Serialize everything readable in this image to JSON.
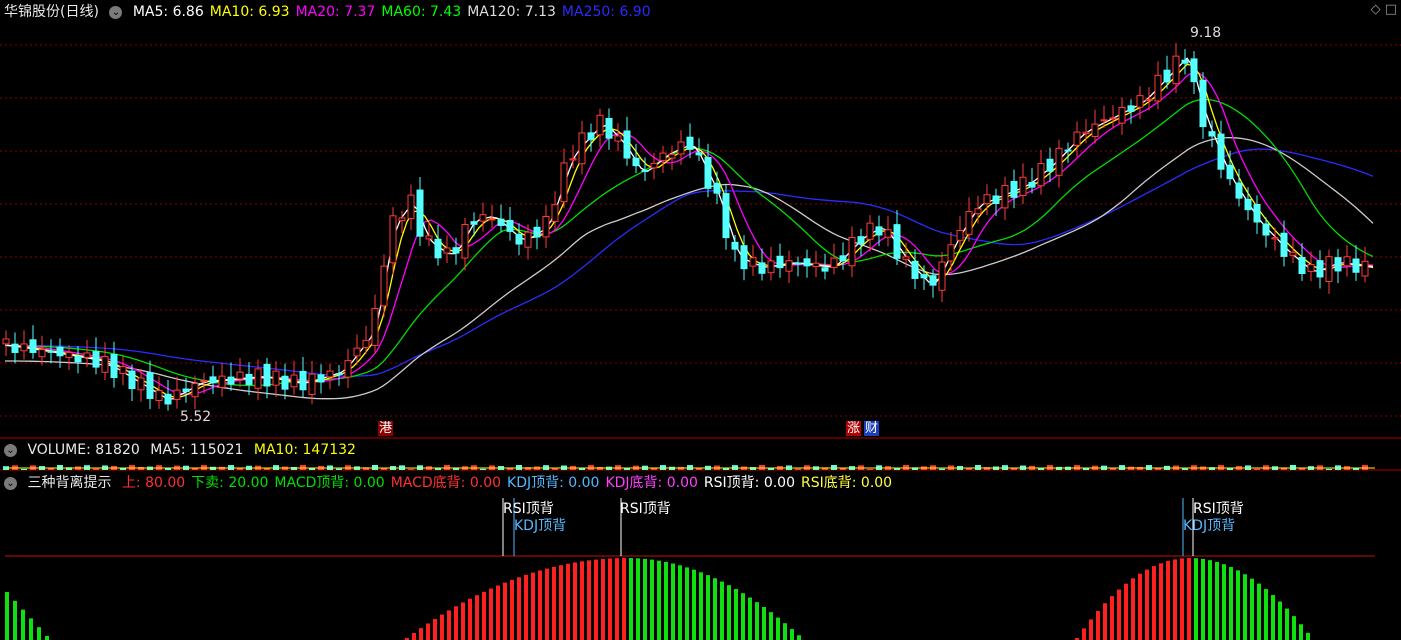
{
  "main": {
    "stock_name": "华锦股份(日线)",
    "ma": [
      {
        "label": "MA5: 6.86",
        "color": "#ffffff"
      },
      {
        "label": "MA10: 6.93",
        "color": "#ffff00"
      },
      {
        "label": "MA20: 7.37",
        "color": "#ff00ff"
      },
      {
        "label": "MA60: 7.43",
        "color": "#00ff00"
      },
      {
        "label": "MA120: 7.13",
        "color": "#dddddd"
      },
      {
        "label": "MA250: 6.90",
        "color": "#2b2bff"
      }
    ],
    "high_label": "9.18",
    "low_label": "5.52",
    "tags": [
      "港",
      "涨",
      "财"
    ]
  },
  "volume": {
    "label": "VOLUME: 81820",
    "ma5": "MA5: 115021",
    "ma10": "MA10: 147132"
  },
  "indicator": {
    "name": "三种背离提示",
    "items": [
      {
        "label": "上: 80.00",
        "color": "#ff3030"
      },
      {
        "label": "下卖: 20.00",
        "color": "#00e000"
      },
      {
        "label": "MACD顶背: 0.00",
        "color": "#00e000"
      },
      {
        "label": "MACD底背: 0.00",
        "color": "#ff3030"
      },
      {
        "label": "KDJ顶背: 0.00",
        "color": "#55b8ff"
      },
      {
        "label": "KDJ底背: 0.00",
        "color": "#ff40ff"
      },
      {
        "label": "RSI顶背: 0.00",
        "color": "#ffffff"
      },
      {
        "label": "RSI底背: 0.00",
        "color": "#ffff40"
      }
    ],
    "signals": [
      {
        "text": "RSI顶背",
        "color": "#ffffff"
      },
      {
        "text": "KDJ顶背",
        "color": "#55b8ff"
      },
      {
        "text": "RSI顶背",
        "color": "#ffffff"
      },
      {
        "text": "RSI顶背",
        "color": "#ffffff"
      },
      {
        "text": "KDJ顶背",
        "color": "#55b8ff"
      }
    ]
  },
  "colors": {
    "up": "#ff3b3b",
    "down": "#54ffff",
    "grid": "#8b0000",
    "divider": "#b00000"
  }
}
